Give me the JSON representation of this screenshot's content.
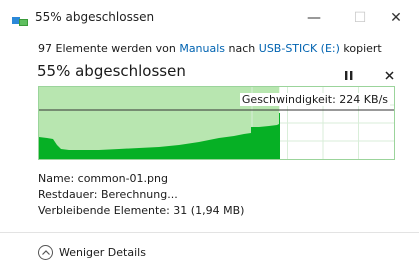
{
  "window": {
    "title": "55% abgeschlossen",
    "minimize_glyph": "—",
    "maximize_glyph": "☐",
    "close_glyph": "✕"
  },
  "status": {
    "prefix": "97 Elemente werden von ",
    "source": "Manuals",
    "middle": " nach ",
    "destination": "USB-STICK (E:)",
    "suffix": " kopiert"
  },
  "progress": {
    "heading": "55% abgeschlossen",
    "percent": 55,
    "speed_label": "Geschwindigkeit: 224 KB/s"
  },
  "details": {
    "name": "Name: common-01.png",
    "remaining_time": "Restdauer: Berechnung...",
    "remaining_items": "Verbleibende Elemente: 31 (1,94 MB)"
  },
  "footer": {
    "toggle_label": "Weniger Details"
  },
  "colors": {
    "accent_link": "#0063b1",
    "progress_fill": "#b8e6b0",
    "speed_fill": "#06b025",
    "grid": "#d9eed9"
  },
  "icons": {
    "app": "file-copy-icon",
    "pause": "pause-icon",
    "cancel": "close-icon",
    "toggle": "chevron-up-icon"
  }
}
